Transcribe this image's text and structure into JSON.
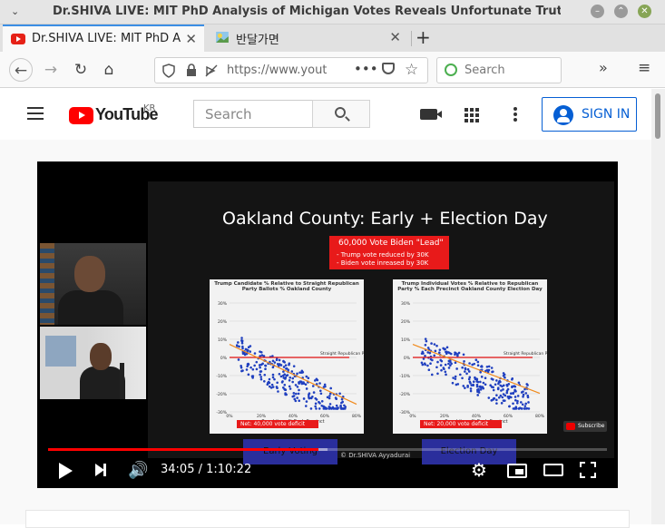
{
  "window": {
    "title": "Dr.SHIVA LIVE: MIT PhD Analysis of Michigan Votes Reveals Unfortunate Truth of U.S. Voting",
    "chevron": "⌄",
    "minimize": "–",
    "maximize": "⌃",
    "close": "✕"
  },
  "tabs": [
    {
      "label": "Dr.SHIVA LIVE: MIT PhD Analysis of Michigan Votes",
      "close": "✕"
    },
    {
      "label": "반달가면",
      "close": "✕"
    }
  ],
  "newtab": "+",
  "nav": {
    "back": "←",
    "forward": "→",
    "reload": "↻",
    "home": "⌂",
    "url": "https://www.youtube.com",
    "page_actions": "•••",
    "bookmark": "☆",
    "search_placeholder": "Search",
    "overflow": "»",
    "menu": "≡"
  },
  "youtube": {
    "logo_text": "YouTube",
    "region": "KR",
    "search_placeholder": "Search",
    "signin_label": "SIGN IN"
  },
  "video": {
    "slide_title": "Oakland County: Early + Election Day",
    "redbox": {
      "headline": "60,000 Vote Biden \"Lead\"",
      "bullet1": "-   Trump vote reduced by 30K",
      "bullet2": "-   Biden vote inreased by 30K"
    },
    "plot1": {
      "title": "Trump Candidate % Relative to Straight Republican Party Ballots % Oakland County",
      "net": "Net:  40,000 vote deficit",
      "party_score": "Straight Republican Party Score",
      "xlabel": "Republican % Each Precinct",
      "y_ticks": [
        "30%",
        "20%",
        "10%",
        "0%",
        "-10%",
        "-20%",
        "-30%"
      ],
      "x_ticks": [
        "0%",
        "20%",
        "40%",
        "60%",
        "80%"
      ]
    },
    "plot2": {
      "title": "Trump Individual Votes % Relative to Republican Party % Each Precinct Oakland County Election Day",
      "net": "Net:  20,000 vote deficit",
      "party_score": "Straight Republican Party Score",
      "xlabel": "Republican % Each Precinct",
      "y_ticks": [
        "30%",
        "20%",
        "10%",
        "0%",
        "-10%",
        "-20%",
        "-30%"
      ],
      "x_ticks": [
        "0%",
        "20%",
        "40%",
        "60%",
        "80%"
      ]
    },
    "early_voting_label": "Early Voting",
    "election_day_label": "Election Day",
    "copyright": "© Dr.SHIVA Ayyadurai",
    "subscribe_label": "Subscribe",
    "time_current": "34:05",
    "time_total": "1:10:22",
    "time_display": "34:05 / 1:10:22",
    "played_fraction": 0.484,
    "buffered_fraction": 0.5,
    "volume_icon": "🔊",
    "settings_icon": "⚙"
  },
  "colors": {
    "accent_blue": "#065fd4",
    "youtube_red": "#ff0000",
    "slide_red": "#e81a1a",
    "button_blue": "#2a2e9c",
    "tab_active_border": "#3b8ee4"
  }
}
